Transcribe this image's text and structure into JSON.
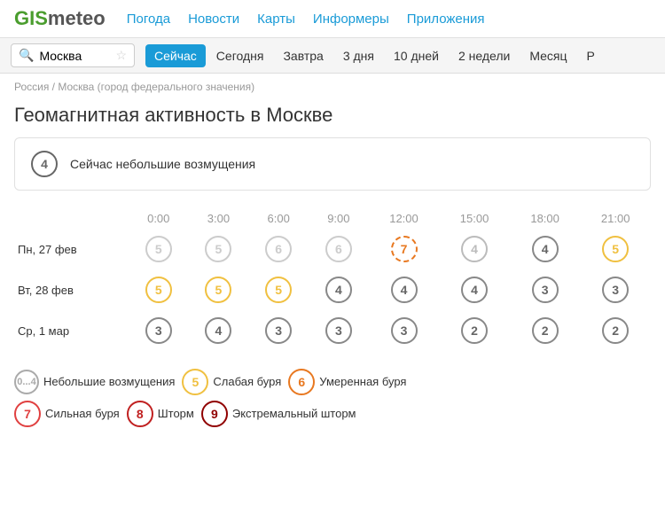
{
  "header": {
    "logo_gis": "GIS",
    "logo_meteo": "meteo",
    "nav": [
      "Погода",
      "Новости",
      "Карты",
      "Информеры",
      "Приложения"
    ]
  },
  "searchbar": {
    "city": "Москва",
    "tabs": [
      "Сейчас",
      "Сегодня",
      "Завтра",
      "3 дня",
      "10 дней",
      "2 недели",
      "Месяц",
      "Р"
    ]
  },
  "breadcrumb": "Россия / Москва (город федерального значения)",
  "page_title": "Геомагнитная активность в Москве",
  "status": {
    "level": "4",
    "text": "Сейчас небольшие возмущения"
  },
  "time_headers": [
    "0:00",
    "3:00",
    "6:00",
    "9:00",
    "12:00",
    "15:00",
    "18:00",
    "21:00"
  ],
  "rows": [
    {
      "day": "Пн, 27 фев",
      "values": [
        {
          "val": "5",
          "type": "gray"
        },
        {
          "val": "5",
          "type": "gray"
        },
        {
          "val": "6",
          "type": "gray"
        },
        {
          "val": "6",
          "type": "gray"
        },
        {
          "val": "7",
          "type": "orange-light"
        },
        {
          "val": "4",
          "type": "white"
        },
        {
          "val": "4",
          "type": "dark"
        },
        {
          "val": "5",
          "type": "yellow"
        }
      ]
    },
    {
      "day": "Вт, 28 фев",
      "values": [
        {
          "val": "5",
          "type": "yellow"
        },
        {
          "val": "5",
          "type": "yellow"
        },
        {
          "val": "5",
          "type": "yellow"
        },
        {
          "val": "4",
          "type": "dark"
        },
        {
          "val": "4",
          "type": "dark"
        },
        {
          "val": "4",
          "type": "dark"
        },
        {
          "val": "3",
          "type": "dark"
        },
        {
          "val": "3",
          "type": "dark"
        }
      ]
    },
    {
      "day": "Ср, 1 мар",
      "values": [
        {
          "val": "3",
          "type": "dark"
        },
        {
          "val": "4",
          "type": "dark"
        },
        {
          "val": "3",
          "type": "dark"
        },
        {
          "val": "3",
          "type": "dark"
        },
        {
          "val": "3",
          "type": "dark"
        },
        {
          "val": "2",
          "type": "dark"
        },
        {
          "val": "2",
          "type": "dark"
        },
        {
          "val": "2",
          "type": "dark"
        }
      ]
    }
  ],
  "legend": [
    {
      "level": "0...4",
      "text": "Небольшие возмущения",
      "type": "dark"
    },
    {
      "level": "5",
      "text": "Слабая буря",
      "type": "yellow"
    },
    {
      "level": "6",
      "text": "Умеренная буря",
      "type": "orange"
    },
    {
      "level": "7",
      "text": "Сильная буря",
      "type": "red"
    },
    {
      "level": "8",
      "text": "Шторм",
      "type": "red2"
    },
    {
      "level": "9",
      "text": "Экстремальный шторм",
      "type": "red3"
    }
  ]
}
